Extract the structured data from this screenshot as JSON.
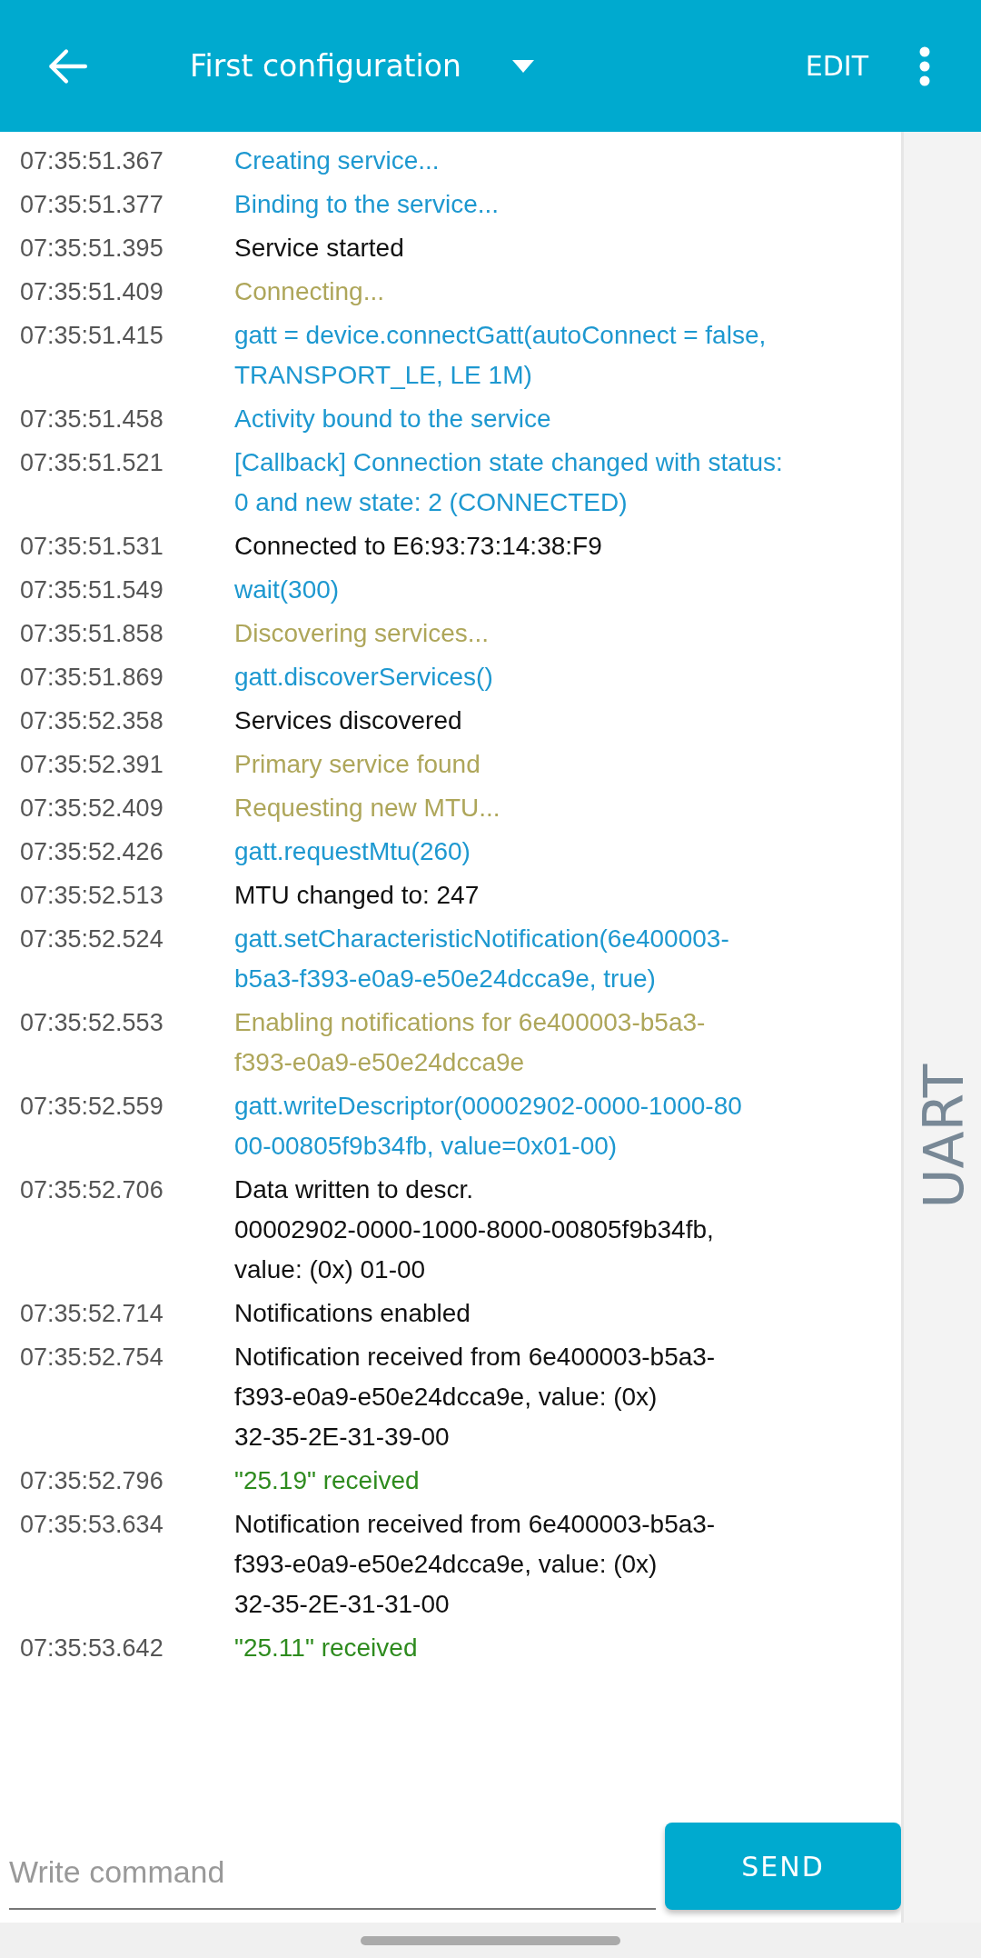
{
  "app_bar": {
    "title": "First configuration",
    "action": "EDIT"
  },
  "log": [
    {
      "time": "07:35:51.367",
      "kind": "debug",
      "lines": [
        "Creating service..."
      ]
    },
    {
      "time": "07:35:51.377",
      "kind": "debug",
      "lines": [
        "Binding to the service..."
      ]
    },
    {
      "time": "07:35:51.395",
      "kind": "info",
      "lines": [
        "Service started"
      ]
    },
    {
      "time": "07:35:51.409",
      "kind": "verbose",
      "lines": [
        "Connecting..."
      ]
    },
    {
      "time": "07:35:51.415",
      "kind": "debug",
      "lines": [
        "gatt = device.connectGatt(autoConnect = false,",
        "TRANSPORT_LE, LE 1M)"
      ]
    },
    {
      "time": "07:35:51.458",
      "kind": "debug",
      "lines": [
        "Activity bound to the service"
      ]
    },
    {
      "time": "07:35:51.521",
      "kind": "debug",
      "lines": [
        "[Callback] Connection state changed with status:",
        "0 and new state: 2 (CONNECTED)"
      ]
    },
    {
      "time": "07:35:51.531",
      "kind": "info",
      "lines": [
        "Connected to E6:93:73:14:38:F9"
      ]
    },
    {
      "time": "07:35:51.549",
      "kind": "debug",
      "lines": [
        "wait(300)"
      ]
    },
    {
      "time": "07:35:51.858",
      "kind": "verbose",
      "lines": [
        "Discovering services..."
      ]
    },
    {
      "time": "07:35:51.869",
      "kind": "debug",
      "lines": [
        "gatt.discoverServices()"
      ]
    },
    {
      "time": "07:35:52.358",
      "kind": "info",
      "lines": [
        "Services discovered"
      ]
    },
    {
      "time": "07:35:52.391",
      "kind": "verbose",
      "lines": [
        "Primary service found"
      ]
    },
    {
      "time": "07:35:52.409",
      "kind": "verbose",
      "lines": [
        "Requesting new MTU..."
      ]
    },
    {
      "time": "07:35:52.426",
      "kind": "debug",
      "lines": [
        "gatt.requestMtu(260)"
      ]
    },
    {
      "time": "07:35:52.513",
      "kind": "info",
      "lines": [
        "MTU changed to: 247"
      ]
    },
    {
      "time": "07:35:52.524",
      "kind": "debug",
      "lines": [
        "gatt.setCharacteristicNotification(6e400003-",
        "b5a3-f393-e0a9-e50e24dcca9e, true)"
      ]
    },
    {
      "time": "07:35:52.553",
      "kind": "verbose",
      "lines": [
        "Enabling notifications for 6e400003-b5a3-",
        "f393-e0a9-e50e24dcca9e"
      ]
    },
    {
      "time": "07:35:52.559",
      "kind": "debug",
      "lines": [
        "gatt.writeDescriptor(00002902-0000-1000-80",
        "00-00805f9b34fb, value=0x01-00)"
      ]
    },
    {
      "time": "07:35:52.706",
      "kind": "info",
      "lines": [
        "Data written to descr.",
        "00002902-0000-1000-8000-00805f9b34fb,",
        "value: (0x) 01-00"
      ]
    },
    {
      "time": "07:35:52.714",
      "kind": "info",
      "lines": [
        "Notifications enabled"
      ]
    },
    {
      "time": "07:35:52.754",
      "kind": "info",
      "lines": [
        "Notification received from 6e400003-b5a3-",
        "f393-e0a9-e50e24dcca9e, value: (0x)",
        "32-35-2E-31-39-00"
      ]
    },
    {
      "time": "07:35:52.796",
      "kind": "application",
      "lines": [
        "\"25.19\" received"
      ]
    },
    {
      "time": "07:35:53.634",
      "kind": "info",
      "lines": [
        "Notification received from 6e400003-b5a3-",
        "f393-e0a9-e50e24dcca9e, value: (0x)",
        "32-35-2E-31-31-00"
      ]
    },
    {
      "time": "07:35:53.642",
      "kind": "application",
      "lines": [
        "\"25.11\" received"
      ]
    }
  ],
  "command_field": {
    "placeholder": "Write command"
  },
  "send_button": "SEND",
  "side_tab": "UART"
}
